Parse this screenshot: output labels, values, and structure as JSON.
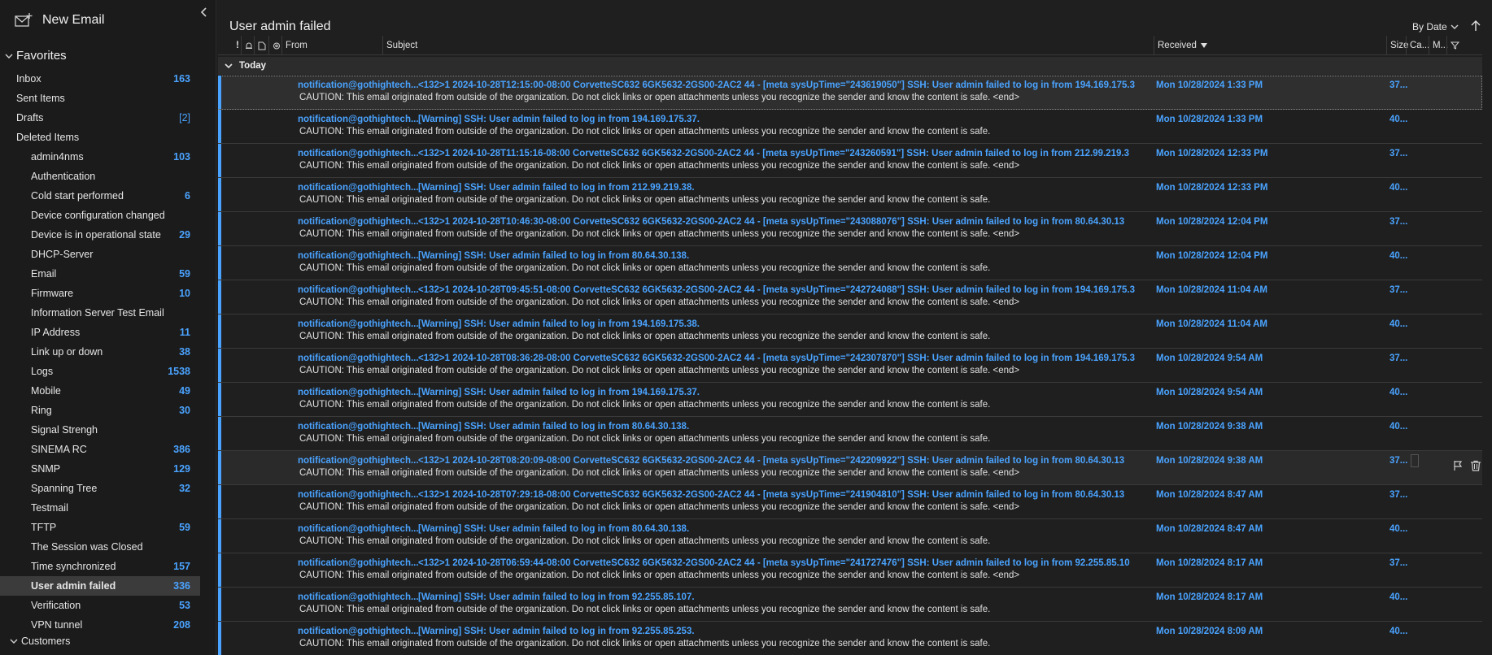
{
  "sidebar": {
    "new_email_label": "New Email",
    "favorites_label": "Favorites",
    "favorites": [
      {
        "label": "Inbox",
        "count": "163"
      },
      {
        "label": "Sent Items",
        "count": ""
      },
      {
        "label": "Drafts",
        "count": "[2]"
      },
      {
        "label": "Deleted Items",
        "count": ""
      }
    ],
    "folders": [
      {
        "label": "admin4nms",
        "count": "103"
      },
      {
        "label": "Authentication",
        "count": ""
      },
      {
        "label": "Cold start performed",
        "count": "6"
      },
      {
        "label": "Device configuration changed",
        "count": ""
      },
      {
        "label": "Device is in operational state",
        "count": "29"
      },
      {
        "label": "DHCP-Server",
        "count": ""
      },
      {
        "label": "Email",
        "count": "59"
      },
      {
        "label": "Firmware",
        "count": "10"
      },
      {
        "label": "Information Server Test Email",
        "count": ""
      },
      {
        "label": "IP Address",
        "count": "11"
      },
      {
        "label": "Link up or down",
        "count": "38"
      },
      {
        "label": "Logs",
        "count": "1538"
      },
      {
        "label": "Mobile",
        "count": "49"
      },
      {
        "label": "Ring",
        "count": "30"
      },
      {
        "label": "Signal Strengh",
        "count": ""
      },
      {
        "label": "SINEMA RC",
        "count": "386"
      },
      {
        "label": "SNMP",
        "count": "129"
      },
      {
        "label": "Spanning Tree",
        "count": "32"
      },
      {
        "label": "Testmail",
        "count": ""
      },
      {
        "label": "TFTP",
        "count": "59"
      },
      {
        "label": "The Session was Closed",
        "count": ""
      },
      {
        "label": "Time synchronized",
        "count": "157"
      },
      {
        "label": "User admin failed",
        "count": "336"
      },
      {
        "label": "Verification",
        "count": "53"
      },
      {
        "label": "VPN tunnel",
        "count": "208"
      }
    ],
    "customers_label": "Customers"
  },
  "main": {
    "folder_title": "User admin failed",
    "sort_label": "By Date",
    "columns": {
      "from": "From",
      "subject": "Subject",
      "received": "Received",
      "size": "Size",
      "categories": "Ca...",
      "mention": "M..."
    },
    "group_label": "Today",
    "messages": [
      {
        "from": "notification@gothightech...",
        "subject": "<132>1 2024-10-28T12:15:00-08:00 CorvetteSC632 6GK5632-2GS00-2AC2 44 - [meta sysUpTime=\"243619050\"] SSH: User admin failed to log in from 194.169.175.3",
        "preview": "CAUTION: This email originated from outside of the organization. Do not click links or open attachments unless you recognize the sender and know the content is safe. <end>",
        "received": "Mon 10/28/2024 1:33 PM",
        "size": "37..."
      },
      {
        "from": "notification@gothightech...",
        "subject": "[Warning] SSH: User admin failed to log in from 194.169.175.37.",
        "preview": "CAUTION: This email originated from outside of the organization. Do not click links or open attachments unless you recognize the sender and know the content is safe.",
        "received": "Mon 10/28/2024 1:33 PM",
        "size": "40..."
      },
      {
        "from": "notification@gothightech...",
        "subject": "<132>1 2024-10-28T11:15:16-08:00 CorvetteSC632 6GK5632-2GS00-2AC2 44 - [meta sysUpTime=\"243260591\"] SSH: User admin failed to log in from 212.99.219.3",
        "preview": "CAUTION: This email originated from outside of the organization. Do not click links or open attachments unless you recognize the sender and know the content is safe. <end>",
        "received": "Mon 10/28/2024 12:33 PM",
        "size": "37..."
      },
      {
        "from": "notification@gothightech...",
        "subject": "[Warning] SSH: User admin failed to log in from 212.99.219.38.",
        "preview": "CAUTION: This email originated from outside of the organization. Do not click links or open attachments unless you recognize the sender and know the content is safe.",
        "received": "Mon 10/28/2024 12:33 PM",
        "size": "40..."
      },
      {
        "from": "notification@gothightech...",
        "subject": "<132>1 2024-10-28T10:46:30-08:00 CorvetteSC632 6GK5632-2GS00-2AC2 44 - [meta sysUpTime=\"243088076\"] SSH: User admin failed to log in from 80.64.30.13",
        "preview": "CAUTION: This email originated from outside of the organization. Do not click links or open attachments unless you recognize the sender and know the content is safe. <end>",
        "received": "Mon 10/28/2024 12:04 PM",
        "size": "37..."
      },
      {
        "from": "notification@gothightech...",
        "subject": "[Warning] SSH: User admin failed to log in from 80.64.30.138.",
        "preview": "CAUTION: This email originated from outside of the organization. Do not click links or open attachments unless you recognize the sender and know the content is safe.",
        "received": "Mon 10/28/2024 12:04 PM",
        "size": "40..."
      },
      {
        "from": "notification@gothightech...",
        "subject": "<132>1 2024-10-28T09:45:51-08:00 CorvetteSC632 6GK5632-2GS00-2AC2 44 - [meta sysUpTime=\"242724088\"] SSH: User admin failed to log in from 194.169.175.3",
        "preview": "CAUTION: This email originated from outside of the organization. Do not click links or open attachments unless you recognize the sender and know the content is safe. <end>",
        "received": "Mon 10/28/2024 11:04 AM",
        "size": "37..."
      },
      {
        "from": "notification@gothightech...",
        "subject": "[Warning] SSH: User admin failed to log in from 194.169.175.38.",
        "preview": "CAUTION: This email originated from outside of the organization. Do not click links or open attachments unless you recognize the sender and know the content is safe.",
        "received": "Mon 10/28/2024 11:04 AM",
        "size": "40..."
      },
      {
        "from": "notification@gothightech...",
        "subject": "<132>1 2024-10-28T08:36:28-08:00 CorvetteSC632 6GK5632-2GS00-2AC2 44 - [meta sysUpTime=\"242307870\"] SSH: User admin failed to log in from 194.169.175.3",
        "preview": "CAUTION: This email originated from outside of the organization. Do not click links or open attachments unless you recognize the sender and know the content is safe. <end>",
        "received": "Mon 10/28/2024 9:54 AM",
        "size": "37..."
      },
      {
        "from": "notification@gothightech...",
        "subject": "[Warning] SSH: User admin failed to log in from 194.169.175.37.",
        "preview": "CAUTION: This email originated from outside of the organization. Do not click links or open attachments unless you recognize the sender and know the content is safe.",
        "received": "Mon 10/28/2024 9:54 AM",
        "size": "40..."
      },
      {
        "from": "notification@gothightech...",
        "subject": "[Warning] SSH: User admin failed to log in from 80.64.30.138.",
        "preview": "CAUTION: This email originated from outside of the organization. Do not click links or open attachments unless you recognize the sender and know the content is safe.",
        "received": "Mon 10/28/2024 9:38 AM",
        "size": "40..."
      },
      {
        "from": "notification@gothightech...",
        "subject": "<132>1 2024-10-28T08:20:09-08:00 CorvetteSC632 6GK5632-2GS00-2AC2 44 - [meta sysUpTime=\"242209922\"] SSH: User admin failed to log in from 80.64.30.13",
        "preview": "CAUTION: This email originated from outside of the organization. Do not click links or open attachments unless you recognize the sender and know the content is safe. <end>",
        "received": "Mon 10/28/2024 9:38 AM",
        "size": "37..."
      },
      {
        "from": "notification@gothightech...",
        "subject": "<132>1 2024-10-28T07:29:18-08:00 CorvetteSC632 6GK5632-2GS00-2AC2 44 - [meta sysUpTime=\"241904810\"] SSH: User admin failed to log in from 80.64.30.13",
        "preview": "CAUTION: This email originated from outside of the organization. Do not click links or open attachments unless you recognize the sender and know the content is safe. <end>",
        "received": "Mon 10/28/2024 8:47 AM",
        "size": "37..."
      },
      {
        "from": "notification@gothightech...",
        "subject": "[Warning] SSH: User admin failed to log in from 80.64.30.138.",
        "preview": "CAUTION: This email originated from outside of the organization. Do not click links or open attachments unless you recognize the sender and know the content is safe.",
        "received": "Mon 10/28/2024 8:47 AM",
        "size": "40..."
      },
      {
        "from": "notification@gothightech...",
        "subject": "<132>1 2024-10-28T06:59:44-08:00 CorvetteSC632 6GK5632-2GS00-2AC2 44 - [meta sysUpTime=\"241727476\"] SSH: User admin failed to log in from 92.255.85.10",
        "preview": "CAUTION: This email originated from outside of the organization. Do not click links or open attachments unless you recognize the sender and know the content is safe. <end>",
        "received": "Mon 10/28/2024 8:17 AM",
        "size": "37..."
      },
      {
        "from": "notification@gothightech...",
        "subject": "[Warning] SSH: User admin failed to log in from 92.255.85.107.",
        "preview": "CAUTION: This email originated from outside of the organization. Do not click links or open attachments unless you recognize the sender and know the content is safe.",
        "received": "Mon 10/28/2024 8:17 AM",
        "size": "40..."
      },
      {
        "from": "notification@gothightech...",
        "subject": "[Warning] SSH: User admin failed to log in from 92.255.85.253.",
        "preview": "CAUTION: This email originated from outside of the organization. Do not click links or open attachments unless you recognize the sender and know the content is safe.",
        "received": "Mon 10/28/2024 8:09 AM",
        "size": "40..."
      }
    ]
  },
  "colors": {
    "accent": "#4aa3ff",
    "background": "#1f1f1f",
    "selected": "#3b3b3b"
  }
}
